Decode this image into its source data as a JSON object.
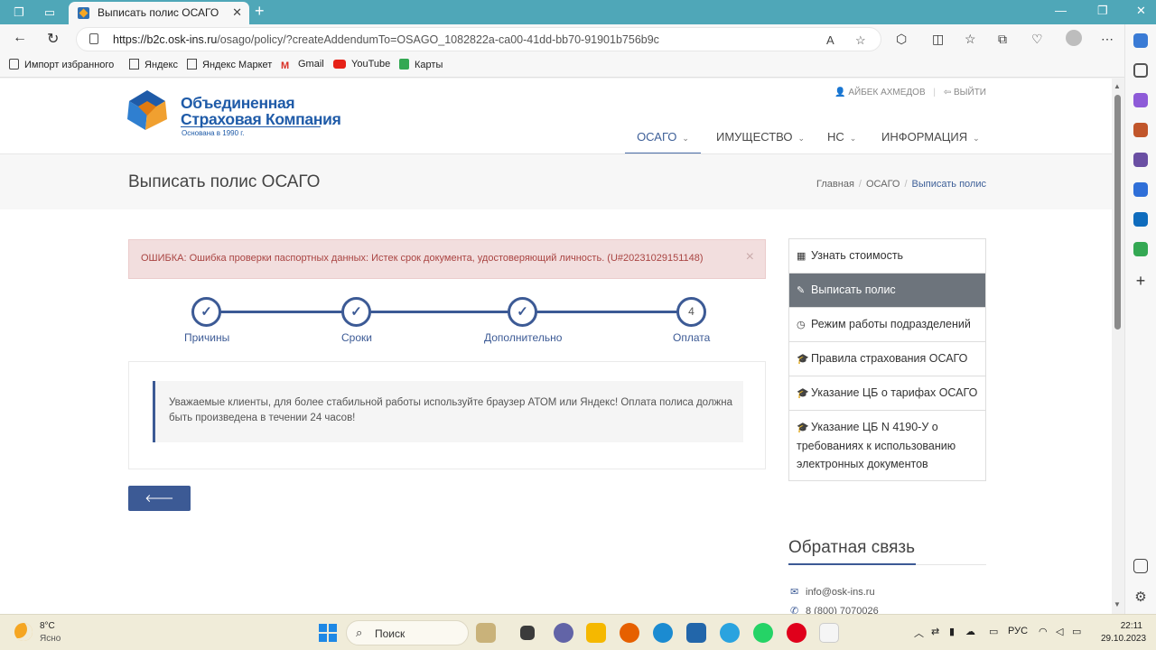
{
  "browser": {
    "tab_title": "Выписать полис ОСАГО",
    "url_host": "https://b2c.osk-ins.ru",
    "url_path": "/osago/policy/?createAddendumTo=OSAGO_1082822a-ca00-41dd-bb70-91901b756b9c",
    "bookmarks": [
      "Импорт избранного",
      "Яндекс",
      "Яндекс Маркет",
      "Gmail",
      "YouTube",
      "Карты"
    ]
  },
  "header": {
    "logo_line1": "Объединенная",
    "logo_line2": "Страховая Компания",
    "logo_sub": "Основана в 1990 г.",
    "user_name": "АЙБЕК АХМЕДОВ",
    "logout": "ВЫЙТИ",
    "nav": [
      "ОСАГО",
      "ИМУЩЕСТВО",
      "НС",
      "ИНФОРМАЦИЯ"
    ]
  },
  "titlebar": {
    "title": "Выписать полис ОСАГО",
    "breadcrumbs": [
      "Главная",
      "ОСАГО",
      "Выписать полис"
    ]
  },
  "alert": {
    "text": "ОШИБКА: Ошибка проверки паспортных данных: Истек срок документа, удостоверяющий личность. (U#20231029151148)",
    "close": "×"
  },
  "steps": [
    {
      "label": "Причины",
      "done": true
    },
    {
      "label": "Сроки",
      "done": true
    },
    {
      "label": "Дополнительно",
      "done": true
    },
    {
      "label": "Оплата",
      "number": "4",
      "done": false
    }
  ],
  "info": {
    "text": "Уважаемые клиенты, для более стабильной работы используйте браузер АТОМ или Яндекс! Оплата полиса должна быть произведена в течении 24 часов!"
  },
  "back_button": "Назад",
  "sidemenu": [
    {
      "icon": "calculator-icon",
      "label": "Узнать стоимость",
      "active": false
    },
    {
      "icon": "edit-icon",
      "label": "Выписать полис",
      "active": true
    },
    {
      "icon": "clock-icon",
      "label": "Режим работы подразделений",
      "active": false
    },
    {
      "icon": "graduation-cap-icon",
      "label": "Правила страхования ОСАГО",
      "active": false
    },
    {
      "icon": "graduation-cap-icon",
      "label": "Указание ЦБ о тарифах ОСАГО",
      "active": false
    },
    {
      "icon": "graduation-cap-icon",
      "label": "Указание ЦБ N 4190-У о требованиях к использованию электронных документов",
      "active": false
    }
  ],
  "feedback": {
    "title": "Обратная связь",
    "email": "info@osk-ins.ru",
    "phone": "8 (800) 7070026"
  },
  "taskbar": {
    "temp": "8°C",
    "weather": "Ясно",
    "search": "Поиск",
    "lang": "РУС",
    "time": "22:11",
    "date": "29.10.2023"
  },
  "colors": {
    "brand": "#3c5a95",
    "alert_bg": "#f2dede",
    "alert_text": "#a94442",
    "active_menu": "#6d747c"
  }
}
